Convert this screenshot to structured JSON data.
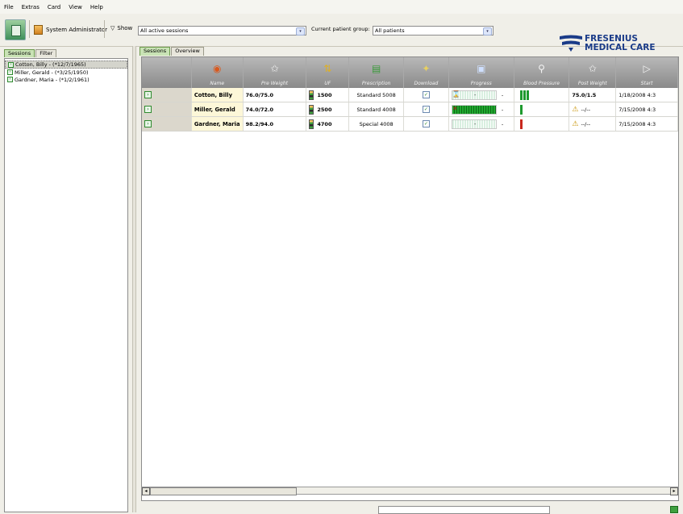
{
  "menu": [
    "File",
    "Extras",
    "Card",
    "View",
    "Help"
  ],
  "toolbar": {
    "user": "System Administrator",
    "show_label": "Show",
    "show_value": "All active sessions",
    "group_label": "Current patient group:",
    "group_value": "All patients",
    "brand_line1": "FRESENIUS",
    "brand_line2": "MEDICAL CARE",
    "brand_color": "#1a3b88"
  },
  "left": {
    "tabs": [
      "Sessions",
      "Filter"
    ],
    "patients": [
      "Cotton, Billy - (*12/7/1965)",
      "Miller, Gerald - (*3/25/1950)",
      "Gardner, Maria - (*1/2/1961)"
    ]
  },
  "right": {
    "tabs": [
      "Sessions",
      "Overview"
    ],
    "columns": [
      "Name",
      "Pre Weight",
      "UF",
      "Prescription",
      "Download",
      "Progress",
      "Blood Pressure",
      "Post Weight",
      "Start"
    ],
    "column_icons": [
      "patients-icon",
      "scale-icon",
      "uf-icon",
      "prescription-icon",
      "download-wand-icon",
      "progress-screen-icon",
      "blood-pressure-icon",
      "scale-icon",
      "play-icon"
    ],
    "rows": [
      {
        "name": "Cotton, Billy",
        "pre_weight": "76.0/75.0",
        "uf": "1500",
        "prescription": "Standard 5008",
        "download": true,
        "progress_text": "-",
        "progress_pct": 0,
        "progress_dash": "-",
        "post_weight": "75.0/1.5",
        "start": "1/18/2008 4:3"
      },
      {
        "name": "Miller, Gerald",
        "pre_weight": "74.0/72.0",
        "uf": "2500",
        "prescription": "Standard 4008",
        "download": true,
        "progress_text": "",
        "progress_pct": 100,
        "progress_dash": "-",
        "post_weight": "--/--",
        "start": "7/15/2008 4:3"
      },
      {
        "name": "Gardner, Maria",
        "pre_weight": "98.2/94.0",
        "uf": "4700",
        "prescription": "Special 4008",
        "download": true,
        "progress_text": "-",
        "progress_pct": 0,
        "progress_dash": "-",
        "post_weight": "--/--",
        "start": "7/15/2008 4:3"
      }
    ]
  }
}
